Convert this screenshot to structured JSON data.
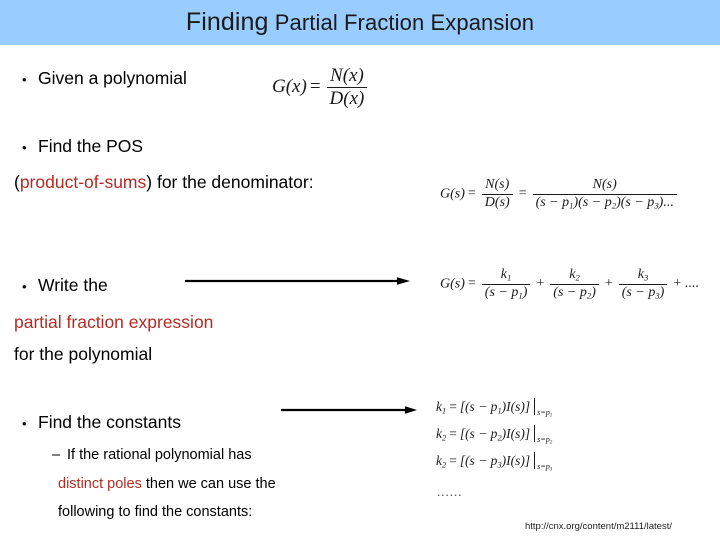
{
  "slide": {
    "title": {
      "lead": "Finding",
      "rest": "Partial Fraction Expansion"
    },
    "accent_blue": "#99ccff",
    "accent_red": "#b52b23",
    "bullets": [
      {
        "id": "given-polynomial",
        "marker": "•",
        "text": "Given a polynomial"
      },
      {
        "id": "find-pos",
        "marker": "•",
        "text": "Find the POS",
        "continuation_prefix": "(",
        "continuation_highlight": "product-of-sums",
        "continuation_suffix": ") for the denominator:"
      },
      {
        "id": "write-expression",
        "marker": "•",
        "text": "Write the",
        "line2_highlight": "partial fraction expression",
        "line3": "for the polynomial"
      },
      {
        "id": "find-constants",
        "marker": "•",
        "text": "Find the constants"
      }
    ],
    "sub_bullet": {
      "marker": "–",
      "line1": "If the rational polynomial has",
      "line2_highlight": "distinct poles",
      "line2_rest": "then we can use the",
      "line3": "following to find the constants:"
    },
    "equations": {
      "eq1": {
        "lhs": "G(x)",
        "eq": "=",
        "numerator": "N(x)",
        "denominator": "D(x)"
      },
      "eq2": {
        "lhs": "G(s)",
        "eq1": "=",
        "num1": "N(s)",
        "den1": "D(s)",
        "eq2": "=",
        "num2": "N(s)",
        "den2": "(s − p1)(s − p2)(s − p3)..."
      },
      "eq3": {
        "lhs": "G(s)",
        "eq": "=",
        "terms": [
          {
            "num": "k1",
            "den": "(s − p1)"
          },
          {
            "num": "k2",
            "den": "(s − p2)"
          },
          {
            "num": "k3",
            "den": "(s − p3)"
          }
        ],
        "tail": "+ ...."
      },
      "eq4": {
        "lines": [
          {
            "k": "k1",
            "body": "[(s − p1)I(s)]",
            "eval": "s=p1"
          },
          {
            "k": "k2",
            "body": "[(s − p2)I(s)]",
            "eval": "s=p2"
          },
          {
            "k": "k2",
            "body": "[(s − p3)I(s)]",
            "eval": "s=p3"
          }
        ],
        "ellipsis": "......"
      }
    },
    "arrows": [
      {
        "id": "arrow-write-expression"
      },
      {
        "id": "arrow-find-constants"
      }
    ],
    "footer_url": "http://cnx.org/content/m2111/latest/"
  }
}
